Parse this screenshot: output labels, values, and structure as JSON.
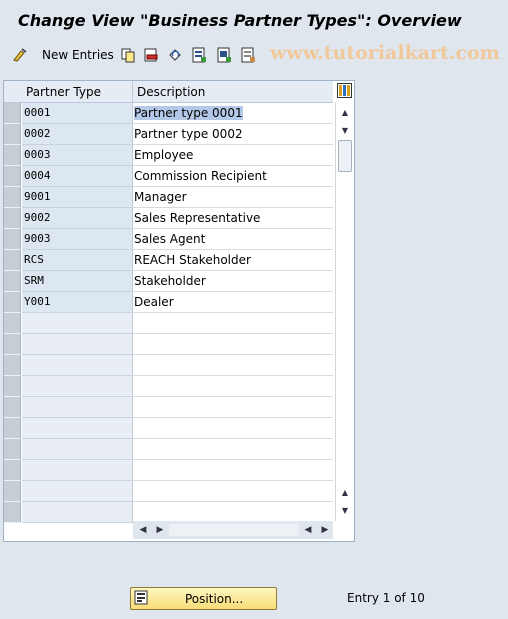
{
  "window": {
    "title": "Change View \"Business Partner Types\": Overview"
  },
  "toolbar": {
    "new_entries_label": "New Entries",
    "icons": [
      "edit-glasses-icon",
      "copy-icon",
      "delete-icon",
      "undo-icon",
      "select-all-icon",
      "select-block-icon",
      "deselect-all-icon"
    ],
    "watermark": "www.tutorialkart.com"
  },
  "table": {
    "columns": [
      "Partner Type",
      "Description"
    ],
    "rows": [
      {
        "type": "0001",
        "desc": "Partner type 0001"
      },
      {
        "type": "0002",
        "desc": "Partner type 0002"
      },
      {
        "type": "0003",
        "desc": "Employee"
      },
      {
        "type": "0004",
        "desc": "Commission Recipient"
      },
      {
        "type": "9001",
        "desc": "Manager"
      },
      {
        "type": "9002",
        "desc": "Sales Representative"
      },
      {
        "type": "9003",
        "desc": "Sales Agent"
      },
      {
        "type": "RCS",
        "desc": "REACH Stakeholder"
      },
      {
        "type": "SRM",
        "desc": "Stakeholder"
      },
      {
        "type": "Y001",
        "desc": "Dealer"
      }
    ],
    "empty_rows": 10
  },
  "footer": {
    "position_label": "Position...",
    "entry_text": "Entry 1 of 10"
  },
  "colors": {
    "accent": "#f8dc78",
    "highlight": "#b4c8e8",
    "key_column": "#dde7f1"
  }
}
